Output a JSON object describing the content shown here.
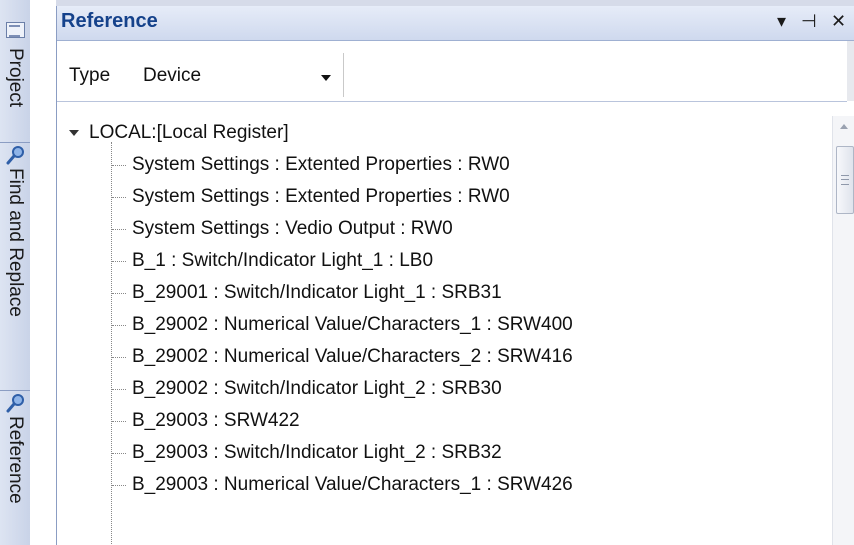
{
  "side_tabs": [
    {
      "label": "Project",
      "icon": "project-icon"
    },
    {
      "label": "Find and Replace",
      "icon": "magnifier-icon"
    },
    {
      "label": "Reference",
      "icon": "magnifier-icon"
    }
  ],
  "panel": {
    "title": "Reference",
    "controls": {
      "menu": "▾",
      "pin": "⊣",
      "close": "✕"
    }
  },
  "type_filter": {
    "label": "Type",
    "value": "Device"
  },
  "tree": {
    "root": "LOCAL:[Local Register]",
    "items": [
      "System Settings : Extented Properties : RW0",
      "System Settings : Extented Properties : RW0",
      "System Settings : Vedio Output : RW0",
      "B_1 : Switch/Indicator Light_1 : LB0",
      "B_29001 : Switch/Indicator Light_1 : SRB31",
      "B_29002 : Numerical Value/Characters_1 : SRW400",
      "B_29002 : Numerical Value/Characters_2 : SRW416",
      "B_29002 : Switch/Indicator Light_2 : SRB30",
      "B_29003 : SRW422",
      "B_29003 : Switch/Indicator Light_2 : SRB32",
      "B_29003 : Numerical Value/Characters_1 : SRW426"
    ]
  },
  "colors": {
    "title_text": "#15428b",
    "title_bar": "#cfd9ee",
    "strip": "#c9d3e8"
  }
}
